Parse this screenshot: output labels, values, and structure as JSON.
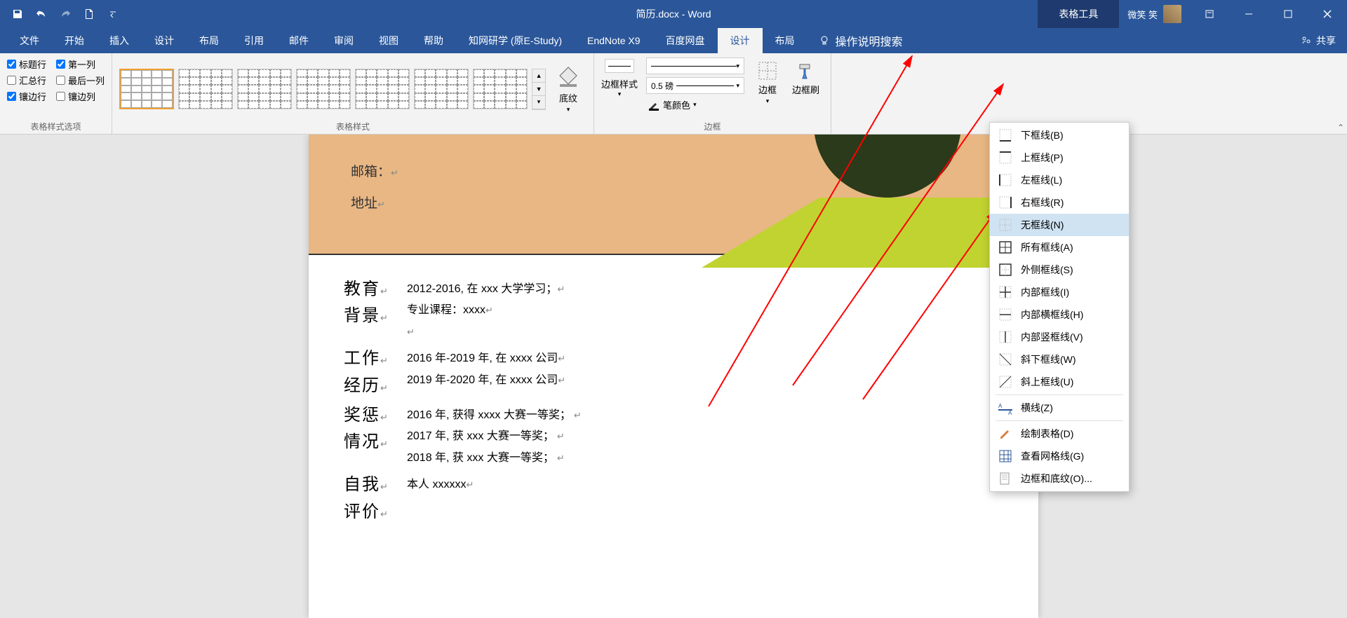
{
  "app": {
    "title": "简历.docx - Word",
    "table_tools": "表格工具",
    "user_name": "微笑 笑",
    "share": "共享"
  },
  "tabs": {
    "file": "文件",
    "home": "开始",
    "insert": "插入",
    "design": "设计",
    "layout": "布局",
    "references": "引用",
    "mailings": "邮件",
    "review": "审阅",
    "view": "视图",
    "help": "帮助",
    "cnki": "知网研学 (原E-Study)",
    "endnote": "EndNote X9",
    "baidu": "百度网盘",
    "table_design": "设计",
    "table_layout": "布局",
    "tell_me": "操作说明搜索"
  },
  "ribbon": {
    "style_options_label": "表格样式选项",
    "table_styles_label": "表格样式",
    "borders_label": "边框",
    "header_row": "标题行",
    "first_column": "第一列",
    "total_row": "汇总行",
    "last_column": "最后一列",
    "banded_rows": "镶边行",
    "banded_columns": "镶边列",
    "shading": "底纹",
    "border_style": "边框样式",
    "pen_weight": "0.5 磅",
    "pen_color": "笔颜色",
    "borders_btn": "边框",
    "border_painter": "边框刷"
  },
  "border_menu": {
    "bottom": "下框线(B)",
    "top": "上框线(P)",
    "left": "左框线(L)",
    "right": "右框线(R)",
    "none": "无框线(N)",
    "all": "所有框线(A)",
    "outside": "外侧框线(S)",
    "inside": "内部框线(I)",
    "inside_h": "内部横框线(H)",
    "inside_v": "内部竖框线(V)",
    "diag_down": "斜下框线(W)",
    "diag_up": "斜上框线(U)",
    "hline": "横线(Z)",
    "draw": "绘制表格(D)",
    "gridlines": "查看网格线(G)",
    "borders_shading": "边框和底纹(O)..."
  },
  "doc": {
    "email": "邮箱：",
    "address": "地址",
    "edu_label": "教育",
    "edu_label2": "背景",
    "edu1": "2012-2016, 在 xxx 大学学习；",
    "edu2": "专业课程：xxxx",
    "work_label": "工作",
    "work_label2": "经历",
    "work1": "2016 年-2019 年, 在 xxxx 公司",
    "work2": "2019 年-2020 年, 在 xxxx 公司",
    "award_label": "奖惩",
    "award_label2": "情况",
    "award1": "2016 年, 获得 xxxx 大赛一等奖；",
    "award2": "2017 年, 获 xxx 大赛一等奖；",
    "award3": "2018 年, 获 xxx 大赛一等奖；",
    "self_label": "自我",
    "self_label2": "评价",
    "self1": "本人 xxxxxx"
  }
}
